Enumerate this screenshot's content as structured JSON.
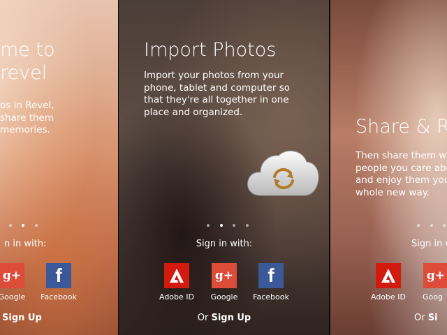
{
  "panels": [
    {
      "title_lines": [
        "me to",
        "revel"
      ],
      "description_lines": [
        "os in Revel,",
        "share them",
        "memories."
      ],
      "signin": "n in with:",
      "buttons": [
        {
          "label": "Google",
          "icon": "google-plus-icon"
        },
        {
          "label": "Facebook",
          "icon": "facebook-icon"
        }
      ],
      "signup_prefix": "",
      "signup_link": "Sign Up"
    },
    {
      "title_lines": [
        "Import Photos"
      ],
      "description_lines": [
        "Import your photos from your",
        "phone, tablet and computer so",
        "that they're all together in one",
        "place and organized."
      ],
      "signin": "Sign in with:",
      "buttons": [
        {
          "label": "Adobe ID",
          "icon": "adobe-icon"
        },
        {
          "label": "Google",
          "icon": "google-plus-icon"
        },
        {
          "label": "Facebook",
          "icon": "facebook-icon"
        }
      ],
      "signup_prefix": "Or ",
      "signup_link": "Sign Up",
      "badge_icon": "cloud-sync-icon"
    },
    {
      "title_lines": [
        "Share & Re"
      ],
      "description_lines": [
        "Then share them wit",
        "people you care abo",
        "and enjoy them you",
        "whole new way."
      ],
      "signin": "Sign in w",
      "buttons": [
        {
          "label": "Adobe ID",
          "icon": "adobe-icon"
        },
        {
          "label": "Goog",
          "icon": "google-plus-icon"
        }
      ],
      "signup_prefix": "Or ",
      "signup_link": "Si"
    }
  ],
  "icons": {
    "google": "g+",
    "facebook": "f"
  },
  "colors": {
    "adobe": "#d31a0f",
    "google": "#dd4b39",
    "facebook": "#3b5998"
  }
}
